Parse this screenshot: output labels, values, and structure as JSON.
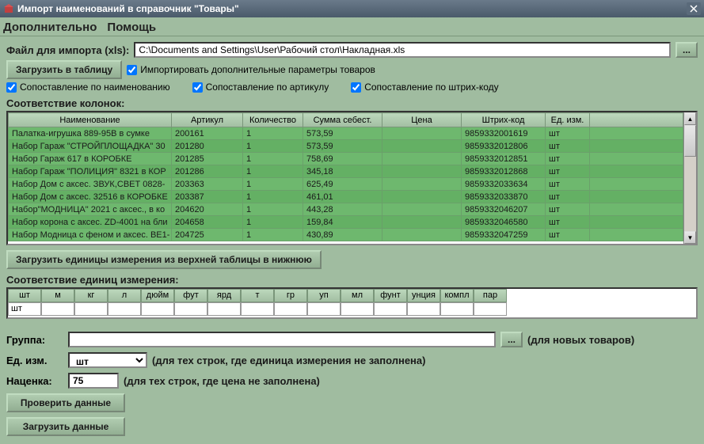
{
  "window": {
    "title": "Импорт наименований в справочник \"Товары\""
  },
  "menu": {
    "extra": "Дополнительно",
    "help": "Помощь"
  },
  "file": {
    "label": "Файл для импорта (xls):",
    "path": "C:\\Documents and Settings\\User\\Рабочий стол\\Накладная.xls",
    "browse": "..."
  },
  "buttons": {
    "load_table": "Загрузить в таблицу",
    "load_units": "Загрузить единицы измерения из верхней таблицы в нижнюю",
    "check": "Проверить данные",
    "upload": "Загрузить данные"
  },
  "checkboxes": {
    "import_extra": "Импортировать дополнительные параметры товаров",
    "by_name": "Сопоставление по наименованию",
    "by_article": "Сопоставление по артикулу",
    "by_barcode": "Сопоставление по штрих-коду"
  },
  "sections": {
    "columns": "Соответствие колонок:",
    "units": "Соответствие единиц измерения:"
  },
  "table": {
    "headers": {
      "name": "Наименование",
      "article": "Артикул",
      "qty": "Количество",
      "sum": "Сумма себест.",
      "price": "Цена",
      "barcode": "Штрих-код",
      "unit": "Ед. изм."
    },
    "rows": [
      {
        "name": "Палатка-игрушка 889-95B в сумке",
        "article": "200161",
        "qty": "1",
        "sum": "573,59",
        "price": "",
        "barcode": "9859332001619",
        "unit": "шт"
      },
      {
        "name": "Набор Гараж \"СТРОЙПЛОЩАДКА\" 30",
        "article": "201280",
        "qty": "1",
        "sum": "573,59",
        "price": "",
        "barcode": "9859332012806",
        "unit": "шт"
      },
      {
        "name": "Набор Гараж 617 в КОРОБКЕ",
        "article": "201285",
        "qty": "1",
        "sum": "758,69",
        "price": "",
        "barcode": "9859332012851",
        "unit": "шт"
      },
      {
        "name": "Набор Гараж \"ПОЛИЦИЯ\" 8321 в КОР",
        "article": "201286",
        "qty": "1",
        "sum": "345,18",
        "price": "",
        "barcode": "9859332012868",
        "unit": "шт"
      },
      {
        "name": "Набор Дом с аксес. ЗВУК,СВЕТ 0828-",
        "article": "203363",
        "qty": "1",
        "sum": "625,49",
        "price": "",
        "barcode": "9859332033634",
        "unit": "шт"
      },
      {
        "name": "Набор Дом с аксес. 32516 в КОРОБКЕ",
        "article": "203387",
        "qty": "1",
        "sum": "461,01",
        "price": "",
        "barcode": "9859332033870",
        "unit": "шт"
      },
      {
        "name": "Набор\"МОДНИЦА\" 2021 с аксес., в ко",
        "article": "204620",
        "qty": "1",
        "sum": "443,28",
        "price": "",
        "barcode": "9859332046207",
        "unit": "шт"
      },
      {
        "name": "Набор корона с аксес. ZD-4001 на бли",
        "article": "204658",
        "qty": "1",
        "sum": "159,84",
        "price": "",
        "barcode": "9859332046580",
        "unit": "шт"
      },
      {
        "name": "Набор Модница с феном и аксес. BE1-",
        "article": "204725",
        "qty": "1",
        "sum": "430,89",
        "price": "",
        "barcode": "9859332047259",
        "unit": "шт"
      }
    ]
  },
  "units": {
    "headers": [
      "шт",
      "м",
      "кг",
      "л",
      "дюйм",
      "фут",
      "ярд",
      "т",
      "гр",
      "уп",
      "мл",
      "фунт",
      "унция",
      "компл",
      "пар"
    ],
    "values": [
      "шт",
      "",
      "",
      "",
      "",
      "",
      "",
      "",
      "",
      "",
      "",
      "",
      "",
      "",
      ""
    ]
  },
  "form": {
    "group_label": "Группа:",
    "group_value": "",
    "group_browse": "...",
    "group_hint": "(для новых товаров)",
    "unit_label": "Ед. изм.",
    "unit_value": "шт",
    "unit_hint": "(для тех строк, где единица измерения не заполнена)",
    "markup_label": "Наценка:",
    "markup_value": "75",
    "markup_hint": "(для тех строк, где цена не заполнена)"
  }
}
